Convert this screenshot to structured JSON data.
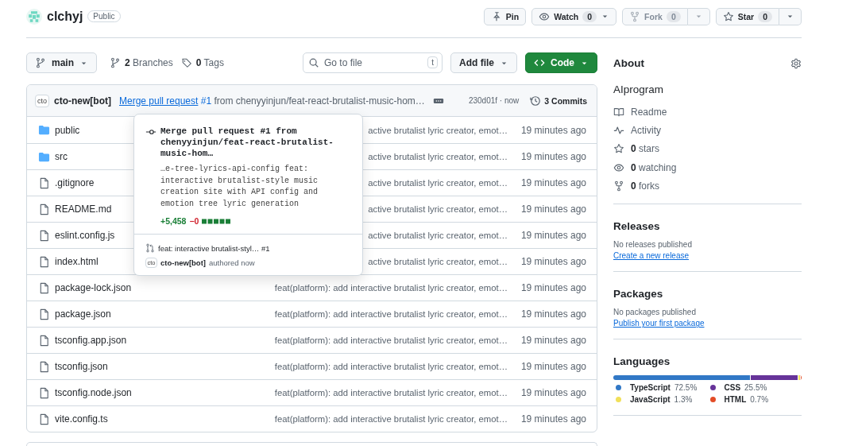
{
  "repo": {
    "name": "clchyj",
    "visibility": "Public"
  },
  "actions": [
    {
      "kind": "plain",
      "label": "Pin",
      "disabled": false
    },
    {
      "kind": "dropdown",
      "label": "Watch",
      "count": "0",
      "disabled": false
    },
    {
      "kind": "split",
      "label": "Fork",
      "count": "0",
      "disabled": true
    },
    {
      "kind": "split",
      "label": "Star",
      "count": "0",
      "disabled": false
    }
  ],
  "toolbar": {
    "branch": "main",
    "branches": "**2** Branches",
    "tags": "**0** Tags",
    "search": {
      "placeholder": "Go to file",
      "key": "t"
    },
    "add_file": "Add file",
    "code": "Code"
  },
  "latest_commit": {
    "avatar_text": "cto",
    "author": "cto-new[bot]",
    "message_link": "Merge pull request",
    "pr_link": "#1",
    "message_rest": "from chenyyinjun/feat-react-brutalist-music-hom…",
    "sha_time": "230d01f · now",
    "commits": "3 Commits"
  },
  "files": [
    {
      "kind": "folder",
      "name": "public",
      "message": "active brutalist lyric creator, emot…",
      "time": "19 minutes ago"
    },
    {
      "kind": "folder",
      "name": "src",
      "message": "active brutalist lyric creator, emot…",
      "time": "19 minutes ago"
    },
    {
      "kind": "file",
      "name": ".gitignore",
      "message": "active brutalist lyric creator, emot…",
      "time": "19 minutes ago"
    },
    {
      "kind": "file",
      "name": "README.md",
      "message": "active brutalist lyric creator, emot…",
      "time": "19 minutes ago"
    },
    {
      "kind": "file",
      "name": "eslint.config.js",
      "message": "active brutalist lyric creator, emot…",
      "time": "19 minutes ago"
    },
    {
      "kind": "file",
      "name": "index.html",
      "message": "active brutalist lyric creator, emot…",
      "time": "19 minutes ago"
    },
    {
      "kind": "file",
      "name": "package-lock.json",
      "message": "feat(platform): add interactive brutalist lyric creator, emot…",
      "time": "19 minutes ago"
    },
    {
      "kind": "file",
      "name": "package.json",
      "message": "feat(platform): add interactive brutalist lyric creator, emot…",
      "time": "19 minutes ago"
    },
    {
      "kind": "file",
      "name": "tsconfig.app.json",
      "message": "feat(platform): add interactive brutalist lyric creator, emot…",
      "time": "19 minutes ago"
    },
    {
      "kind": "file",
      "name": "tsconfig.json",
      "message": "feat(platform): add interactive brutalist lyric creator, emot…",
      "time": "19 minutes ago"
    },
    {
      "kind": "file",
      "name": "tsconfig.node.json",
      "message": "feat(platform): add interactive brutalist lyric creator, emot…",
      "time": "19 minutes ago"
    },
    {
      "kind": "file",
      "name": "vite.config.ts",
      "message": "feat(platform): add interactive brutalist lyric creator, emot…",
      "time": "19 minutes ago"
    }
  ],
  "popover": {
    "title": "Merge pull request #1 from chenyyinjun/feat-react-brutalist-music-hom…",
    "body": "…e-tree-lyrics-api-config feat: interactive brutalist-style music creation site with API config and emotion tree lyric generation",
    "additions": "+5,458",
    "deletions": "−0",
    "pr_title": "feat: interactive brutalist-styl… #1",
    "avatar_text": "cto",
    "author": "cto-new[bot]",
    "authored": "authored now"
  },
  "about": {
    "title": "About",
    "description": "AIprogram",
    "links": [
      {
        "text": "Readme"
      },
      {
        "text": "Activity"
      },
      {
        "text": "**0** stars"
      },
      {
        "text": "**0** watching"
      },
      {
        "text": "**0** forks"
      }
    ]
  },
  "releases": {
    "title": "Releases",
    "note": "No releases published",
    "link": "Create a new release"
  },
  "packages": {
    "title": "Packages",
    "note": "No packages published",
    "link": "Publish your first package"
  },
  "languages": {
    "title": "Languages",
    "items": [
      {
        "name": "TypeScript",
        "percent": "72.5%",
        "level": 0.725,
        "color": "#3178c6"
      },
      {
        "name": "CSS",
        "percent": "25.5%",
        "level": 0.255,
        "color": "#663399"
      },
      {
        "name": "JavaScript",
        "percent": "1.3%",
        "level": 0.013,
        "color": "#f1e05a"
      },
      {
        "name": "HTML",
        "percent": "0.7%",
        "level": 0.007,
        "color": "#e34c26"
      }
    ]
  }
}
